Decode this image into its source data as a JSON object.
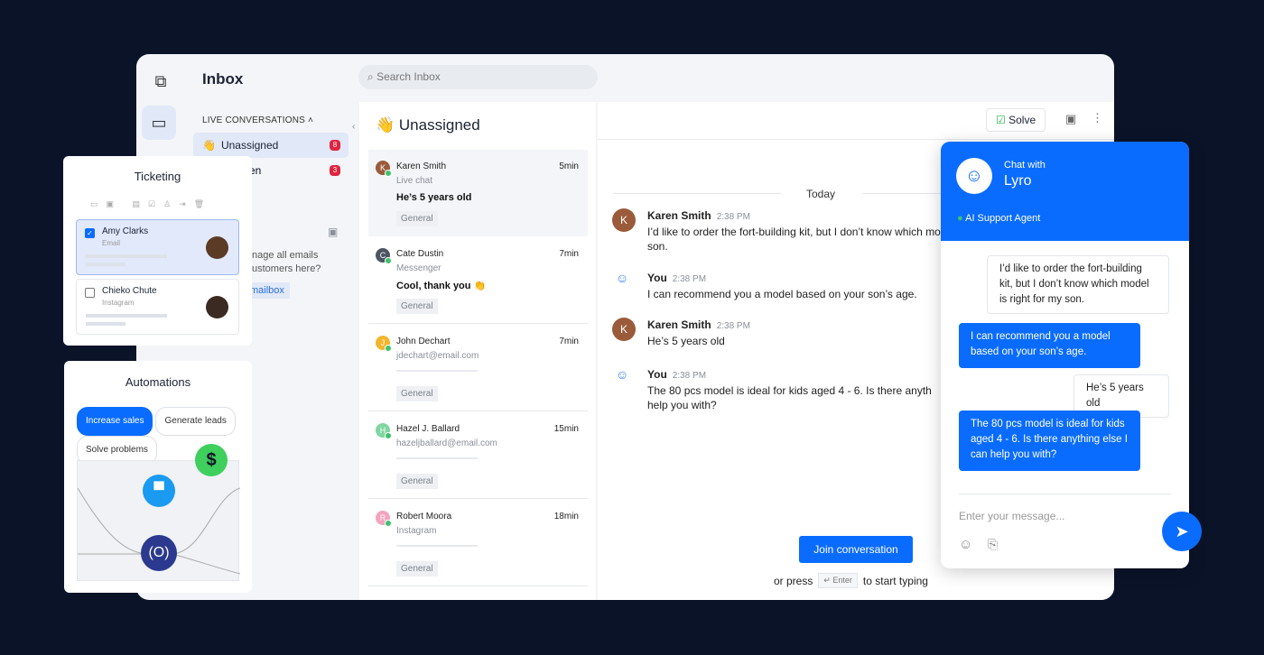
{
  "inbox": {
    "title": "Inbox",
    "search_placeholder": "Search Inbox",
    "section": "LIVE CONVERSATIONS",
    "items": [
      {
        "emoji": "👋",
        "label": "Unassigned",
        "count": "8"
      },
      {
        "label": "Open",
        "visible_text": "en",
        "count": "3"
      }
    ],
    "email_prompt": "…nage all emails …ustomers here?",
    "email_prompt_l1": "nage all emails",
    "email_prompt_l2": "ustomers here?",
    "email_button": "mailbox"
  },
  "list": {
    "title": "Unassigned",
    "emoji": "👋",
    "conversations": [
      {
        "initial": "K",
        "name": "Karen Smith",
        "time": "5min",
        "channel": "Live chat",
        "message": "He’s 5 years old",
        "tag": "General",
        "color": "#9a5b3a"
      },
      {
        "initial": "C",
        "name": "Cate Dustin",
        "time": "7min",
        "channel": "Messenger",
        "message": "Cool, thank you 👏",
        "tag": "General",
        "color": "#4b5563"
      },
      {
        "initial": "J",
        "name": "John Dechart",
        "time": "7min",
        "channel": "jdechart@email.com",
        "message": "",
        "tag": "General",
        "color": "#f4b52b"
      },
      {
        "initial": "H",
        "name": "Hazel J. Ballard",
        "time": "15min",
        "channel": "hazeljballard@email.com",
        "message": "",
        "tag": "General",
        "color": "#7fd6a0"
      },
      {
        "initial": "R",
        "name": "Robert Moora",
        "time": "18min",
        "channel": "Instagram",
        "message": "",
        "tag": "General",
        "color": "#f5a3bf"
      }
    ]
  },
  "chat": {
    "solve": "Solve",
    "date": "Today",
    "messages": [
      {
        "author": "Karen Smith",
        "time": "2:38 PM",
        "text": "I’d like to order the fort-building kit, but I don’t know which model is right for my son.",
        "visible": "I’d like to order the fort-building kit, but I don’t know which mo son."
      },
      {
        "author": "You",
        "time": "2:38 PM",
        "text": "I can recommend you a model based on your son’s age."
      },
      {
        "author": "Karen Smith",
        "time": "2:38 PM",
        "text": "He’s 5 years old"
      },
      {
        "author": "You",
        "time": "2:38 PM",
        "text": "The 80 pcs model is ideal for kids aged 4 - 6. Is there anyth help you with?"
      }
    ],
    "join": "Join conversation",
    "or_press": "or press",
    "enter_key": "↵ Enter",
    "to_start": "to start typing"
  },
  "ticketing": {
    "title": "Ticketing",
    "tickets": [
      {
        "name": "Amy Clarks",
        "channel": "Email",
        "checked": true
      },
      {
        "name": "Chieko Chute",
        "channel": "Instagram",
        "checked": false
      }
    ]
  },
  "automations": {
    "title": "Automations",
    "pills": [
      "Increase sales",
      "Generate leads",
      "Solve problems"
    ],
    "dollar": "$"
  },
  "lyro": {
    "chat_with": "Chat with",
    "name": "Lyro",
    "status": "AI Support Agent",
    "messages": [
      {
        "from": "user",
        "text": "I’d like to order the fort-building kit, but I don’t know which model is right for my son."
      },
      {
        "from": "bot",
        "text": "I can recommend you a model based on your son’s age."
      },
      {
        "from": "user",
        "text": "He’s 5 years old"
      },
      {
        "from": "bot",
        "text": "The 80 pcs model is ideal for kids aged 4 - 6. Is there anything else I can help you with?"
      }
    ],
    "input_placeholder": "Enter your message..."
  },
  "colors": {
    "accent": "#0a6cff",
    "background": "#0b1329",
    "badge": "#e0243f",
    "online": "#3ec26a"
  }
}
